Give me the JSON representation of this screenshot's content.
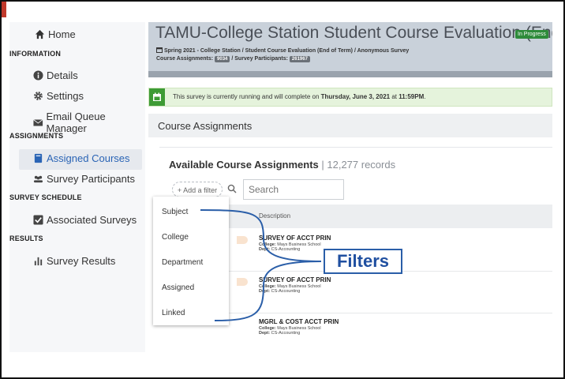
{
  "sidebar": {
    "home": "Home",
    "sections": {
      "information": "INFORMATION",
      "assignments": "ASSIGNMENTS",
      "survey_schedule": "SURVEY SCHEDULE",
      "results": "RESULTS"
    },
    "items": {
      "details": "Details",
      "settings": "Settings",
      "email_queue": "Email Queue Manager",
      "assigned_courses": "Assigned Courses",
      "survey_participants": "Survey Participants",
      "associated_surveys": "Associated Surveys",
      "survey_results": "Survey Results"
    }
  },
  "header": {
    "title": "TAMU-College Station Student Course Evaluation (End-of-Term)",
    "status_badge": "In Progress",
    "breadcrumb": "Spring 2021 - College Station / Student Course Evaluation  (End of Term)  / Anonymous Survey",
    "course_assignments_label": "Course Assignments:",
    "course_assignments_count": "9034",
    "survey_participants_label": "/ Survey Participants:",
    "survey_participants_count": "261967"
  },
  "alert": {
    "text_prefix": "This survey is currently running and will complete on ",
    "date": "Thursday, June 3, 2021",
    "text_mid": " at ",
    "time": "11:59PM",
    "text_suffix": "."
  },
  "section_title": "Course Assignments",
  "card": {
    "title": "Available Course Assignments",
    "separator": " | ",
    "record_count": "12,277 records",
    "add_filter": "+ Add a filter",
    "search_placeholder": "Search",
    "column_description": "Description"
  },
  "rows": [
    {
      "title": "SURVEY OF ACCT PRIN",
      "college_label": "College:",
      "college": "Mays Business School",
      "dept_label": "Dept:",
      "dept": "CS-Accounting"
    },
    {
      "title": "SURVEY OF ACCT PRIN",
      "college_label": "College:",
      "college": "Mays Business School",
      "dept_label": "Dept:",
      "dept": "CS-Accounting"
    },
    {
      "title": "MGRL & COST ACCT PRIN",
      "college_label": "College:",
      "college": "Mays Business School",
      "dept_label": "Dept:",
      "dept": "CS-Accounting"
    }
  ],
  "filter_menu": {
    "subject": "Subject",
    "college": "College",
    "department": "Department",
    "assigned": "Assigned",
    "linked": "Linked"
  },
  "annotation": {
    "label": "Filters",
    "color": "#1f4fa0"
  },
  "icons": {
    "home": "home-icon",
    "details": "info-icon",
    "settings": "gear-icon",
    "email": "envelope-icon",
    "assigned": "book-icon",
    "participants": "people-icon",
    "associated": "checkbox-icon",
    "results": "bar-chart-icon",
    "calendar": "calendar-icon",
    "search": "search-icon"
  }
}
